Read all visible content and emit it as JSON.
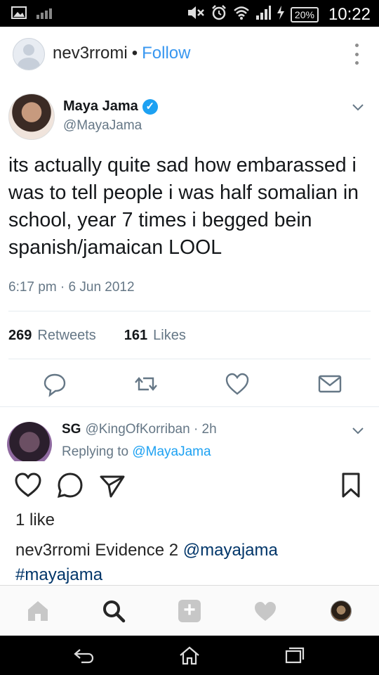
{
  "status_bar": {
    "battery": "20%",
    "time": "10:22"
  },
  "post": {
    "username": "nev3rromi",
    "separator": "•",
    "follow_label": "Follow"
  },
  "tweet": {
    "name": "Maya Jama",
    "handle": "@MayaJama",
    "text": "its actually quite sad how embarassed i was to tell people i was half somalian in school, year 7 times i begged bein spanish/jamaican LOOL",
    "timestamp": "6:17 pm · 6 Jun 2012",
    "retweets_count": "269",
    "retweets_label": "Retweets",
    "likes_count": "161",
    "likes_label": "Likes",
    "reply": {
      "name": "SG",
      "handle": "@KingOfKorriban",
      "time": "· 2h",
      "replying_prefix": "Replying to",
      "replying_to": "@MayaJama"
    }
  },
  "ig": {
    "likes_text": "1 like",
    "caption_user": "nev3rromi",
    "caption_text": "Evidence 2",
    "caption_mention": "@mayajama",
    "caption_hashtag": "#mayajama"
  },
  "icons": {
    "accent_blue": "#3897f0",
    "twitter_blue": "#1da1f2"
  }
}
